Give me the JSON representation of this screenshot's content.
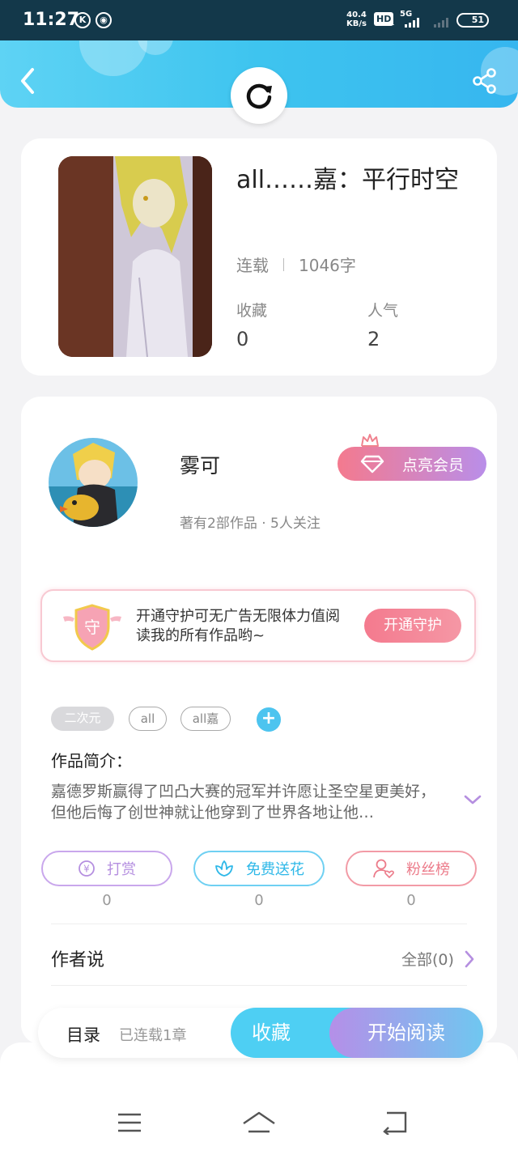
{
  "status_bar": {
    "time": "11:27",
    "left_icons": [
      "K",
      "◉"
    ],
    "net_speed_value": "40.4",
    "net_speed_unit": "KB/s",
    "hd_label": "HD",
    "hd_sub": "1",
    "network_label": "5G",
    "battery": "51"
  },
  "header": {
    "back_icon": "chevron-left-icon",
    "share_icon": "share-icon",
    "refresh_icon": "refresh-icon",
    "colors": {
      "gradient_start": "#5ed3f4",
      "gradient_end": "#36b6ef"
    }
  },
  "book": {
    "title": "all……嘉：平行时空",
    "status": "连载",
    "word_count": "1046字",
    "favorites_label": "收藏",
    "favorites_value": "0",
    "popularity_label": "人气",
    "popularity_value": "2"
  },
  "author": {
    "name": "雾可",
    "meta": "著有2部作品 · 5人关注",
    "member_button": "点亮会员"
  },
  "guard": {
    "shield_char": "守",
    "text": "开通守护可无广告无限体力值阅读我的所有作品哟~",
    "button": "开通守护"
  },
  "tags": [
    "二次元",
    "all",
    "all嘉"
  ],
  "tag_add": "+",
  "intro": {
    "label": "作品简介：",
    "text": "嘉德罗斯赢得了凹凸大赛的冠军并许愿让圣空星更美好，但他后悔了创世神就让他穿到了世界各地让他…"
  },
  "actions": [
    {
      "label": "打赏",
      "icon": "yen-coin-icon",
      "count": "0",
      "color": "#b58fe0"
    },
    {
      "label": "免费送花",
      "icon": "flower-icon",
      "count": "0",
      "color": "#4dc4ef"
    },
    {
      "label": "粉丝榜",
      "icon": "fan-user-icon",
      "count": "0",
      "color": "#f0828f"
    }
  ],
  "author_says": {
    "label": "作者说",
    "all_label": "全部(0)"
  },
  "read_bar": {
    "toc_label": "目录",
    "toc_sub": "已连载1章",
    "favorite_button": "收藏",
    "read_button": "开始阅读"
  },
  "system_nav": [
    "menu-icon",
    "home-icon",
    "back-icon"
  ]
}
